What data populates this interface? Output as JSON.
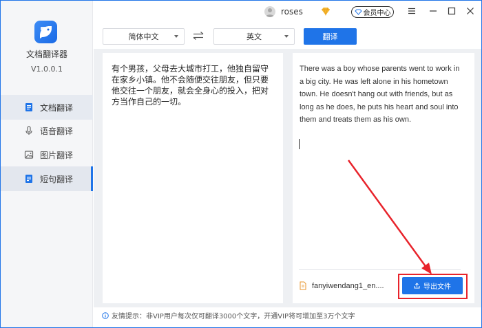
{
  "app": {
    "name": "文档翻译器",
    "version": "V1.0.0.1"
  },
  "user": {
    "name": "roses",
    "member_label": "会员中心"
  },
  "sidebar": {
    "items": [
      {
        "label": "文档翻译",
        "icon": "document-icon"
      },
      {
        "label": "语音翻译",
        "icon": "microphone-icon"
      },
      {
        "label": "图片翻译",
        "icon": "image-icon"
      },
      {
        "label": "短句翻译",
        "icon": "sentence-icon"
      }
    ],
    "active_index": 3
  },
  "toolbar": {
    "source_lang": "简体中文",
    "target_lang": "英文",
    "translate_label": "翻译"
  },
  "source_text": "有个男孩，父母去大城市打工，他独自留守在家乡小镇。他不会随便交往朋友，但只要他交往一个朋友，就会全身心的投入，把对方当作自己的一切。",
  "translated_text": "There was a boy whose parents went to work in a big city. He was left alone in his hometown town. He doesn't hang out with friends, but as long as he does, he puts his heart and soul into them and treats them as his own.",
  "file": {
    "name": "fanyiwendang1_en...."
  },
  "export_label": "导出文件",
  "tip": "友情提示：非VIP用户每次仅可翻译3000个文字，开通VIP将可增加至3万个文字",
  "colors": {
    "accent": "#1f74e8",
    "highlight": "#e8232b",
    "sidebar_bg": "#f5f6f8"
  }
}
